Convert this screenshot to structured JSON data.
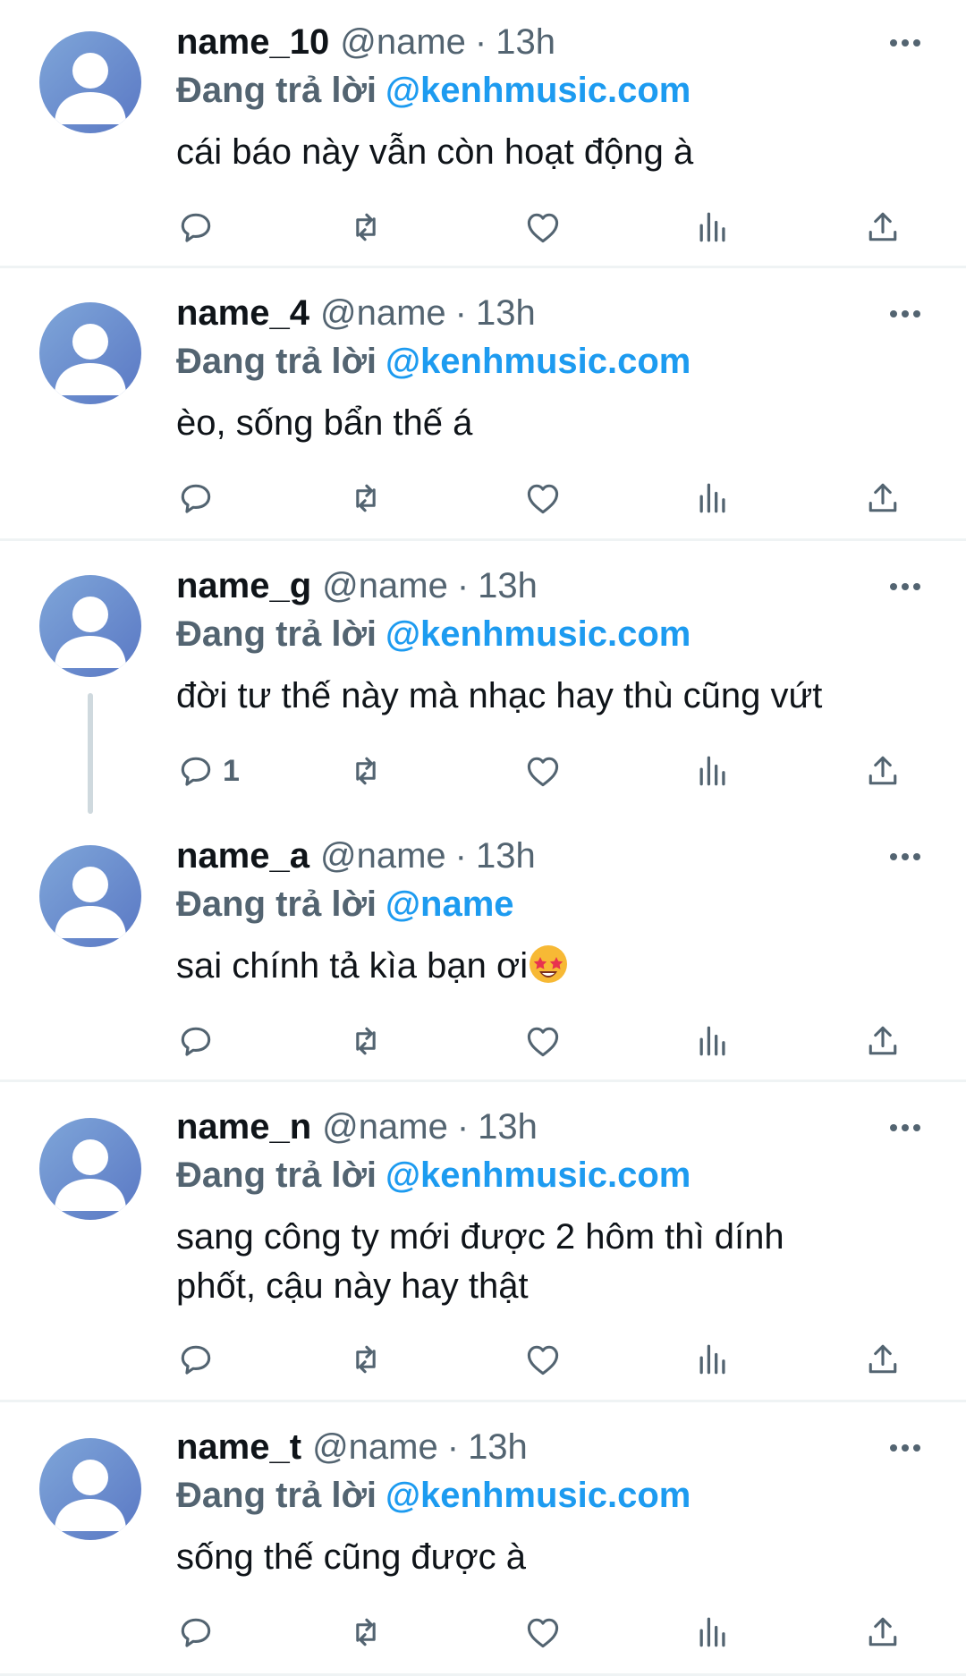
{
  "tweets": [
    {
      "name": "name_10",
      "handle": "@name",
      "separator": "·",
      "time": "13h",
      "replying_label": "Đang trả lời",
      "replying_to": "@kenhmusic.com",
      "text": "cái báo này vẫn còn hoạt động à",
      "reply_count": ""
    },
    {
      "name": "name_4",
      "handle": "@name",
      "separator": "·",
      "time": "13h",
      "replying_label": "Đang trả lời",
      "replying_to": "@kenhmusic.com",
      "text": "èo, sống bẩn thế á",
      "reply_count": ""
    },
    {
      "name": "name_g",
      "handle": "@name",
      "separator": "·",
      "time": "13h",
      "replying_label": "Đang trả lời",
      "replying_to": "@kenhmusic.com",
      "text": "đời tư thế này mà nhạc hay thù cũng vứt",
      "reply_count": "1"
    },
    {
      "name": "name_a",
      "handle": "@name",
      "separator": "·",
      "time": "13h",
      "replying_label": "Đang trả lời",
      "replying_to": "@name",
      "text": "sai chính tả kìa bạn ơi",
      "emoji": "star-struck-emoji",
      "reply_count": ""
    },
    {
      "name": "name_n",
      "handle": "@name",
      "separator": "·",
      "time": "13h",
      "replying_label": "Đang trả lời",
      "replying_to": "@kenhmusic.com",
      "text_lines": [
        "sang công ty mới được 2 hôm thì dính",
        "phốt, cậu này hay thật"
      ],
      "reply_count": ""
    },
    {
      "name": "name_t",
      "handle": "@name",
      "separator": "·",
      "time": "13h",
      "replying_label": "Đang trả lời",
      "replying_to": "@kenhmusic.com",
      "text": "sống thế cũng được à",
      "reply_count": ""
    }
  ],
  "icons": {
    "avatar": "default-avatar-icon",
    "more": "more-options-icon",
    "reply": "reply-icon",
    "retweet": "retweet-icon",
    "like": "like-icon",
    "views": "views-icon",
    "share": "share-icon"
  },
  "colors": {
    "name": "#0f1419",
    "secondary": "#536471",
    "link": "#1d9bf0",
    "divider": "#eff3f4",
    "avatar_bg": "#6b93cf",
    "avatar_fg": "#ffffff"
  }
}
